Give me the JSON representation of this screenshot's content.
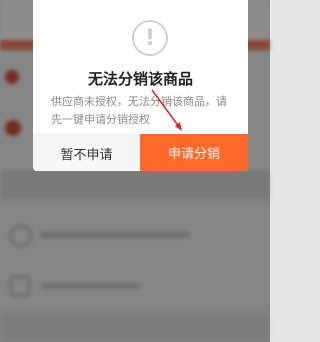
{
  "dialog": {
    "icon": "alert-circle-icon",
    "title": "无法分销该商品",
    "message": "供应商未授权，无法分销该商品，请先一键申请分销授权",
    "cancel_label": "暂不申请",
    "apply_label": "申请分销"
  },
  "colors": {
    "accent": "#ff6a2a",
    "annotation_arrow": "#d9262b"
  }
}
